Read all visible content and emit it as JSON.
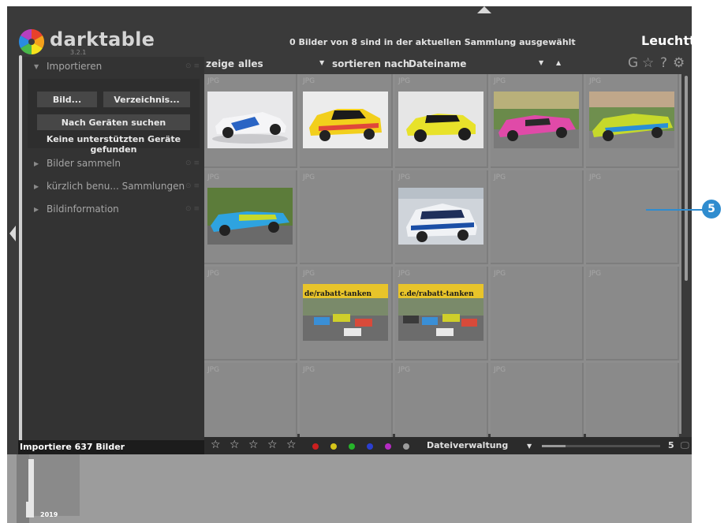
{
  "app": {
    "brand": "darktable",
    "version": "3.2.1",
    "view": "Leuchttisch"
  },
  "header": {
    "selection_info": "0 Bilder von 8 sind in der aktuellen Sammlung ausgewählt"
  },
  "left_panel": {
    "import_module": {
      "title": "Importieren"
    },
    "buttons": {
      "image": "Bild...",
      "folder": "Verzeichnis...",
      "scan_devices": "Nach Geräten suchen"
    },
    "no_devices": "Keine unterstützten Geräte gefunden",
    "modules": [
      {
        "title": "Bilder sammeln"
      },
      {
        "title": "kürzlich benu... Sammlungen"
      },
      {
        "title": "Bildinformation"
      }
    ],
    "import_status": "Importiere 637 Bilder"
  },
  "toolbar": {
    "show_label": "zeige",
    "show_value": "alles",
    "sort_label": "sortieren nach",
    "sort_value": "Dateiname",
    "icons": [
      "grouping-icon",
      "star-overlay-icon",
      "help-icon",
      "preferences-gear-icon"
    ]
  },
  "grid": {
    "cells": [
      {
        "label": "JPG",
        "thumb": "white-blue-roadster"
      },
      {
        "label": "JPG",
        "thumb": "yellow-rally-car"
      },
      {
        "label": "JPG",
        "thumb": "yellow-smart-roadster"
      },
      {
        "label": "JPG",
        "thumb": "pink-race-car"
      },
      {
        "label": "JPG",
        "thumb": "yellow-green-audi"
      },
      {
        "label": "JPG",
        "thumb": "blue-green-race-car"
      },
      {
        "label": "JPG",
        "thumb": ""
      },
      {
        "label": "JPG",
        "thumb": "white-blue-hyundai"
      },
      {
        "label": "JPG",
        "thumb": ""
      },
      {
        "label": "JPG",
        "thumb": ""
      },
      {
        "label": "JPG",
        "thumb": ""
      },
      {
        "label": "JPG",
        "thumb": "race-start-1",
        "banner": "de/rabatt-tanken"
      },
      {
        "label": "JPG",
        "thumb": "race-start-2",
        "banner": "c.de/rabatt-tanken"
      },
      {
        "label": "JPG",
        "thumb": ""
      },
      {
        "label": "JPG",
        "thumb": ""
      },
      {
        "label": "JPG",
        "thumb": ""
      },
      {
        "label": "JPG",
        "thumb": ""
      },
      {
        "label": "JPG",
        "thumb": ""
      },
      {
        "label": "JPG",
        "thumb": ""
      },
      {
        "label": ""
      }
    ]
  },
  "bottom_bar": {
    "color_labels": [
      "#cc1f1f",
      "#d6c41a",
      "#26b52a",
      "#2b3fd0",
      "#b52bc2",
      "#9c9c9c"
    ],
    "layout": "Dateiverwaltung",
    "zoom_value": "5",
    "zoom_fraction": 0.2
  },
  "timeline": {
    "year": "2019"
  },
  "callout": {
    "number": "5"
  }
}
